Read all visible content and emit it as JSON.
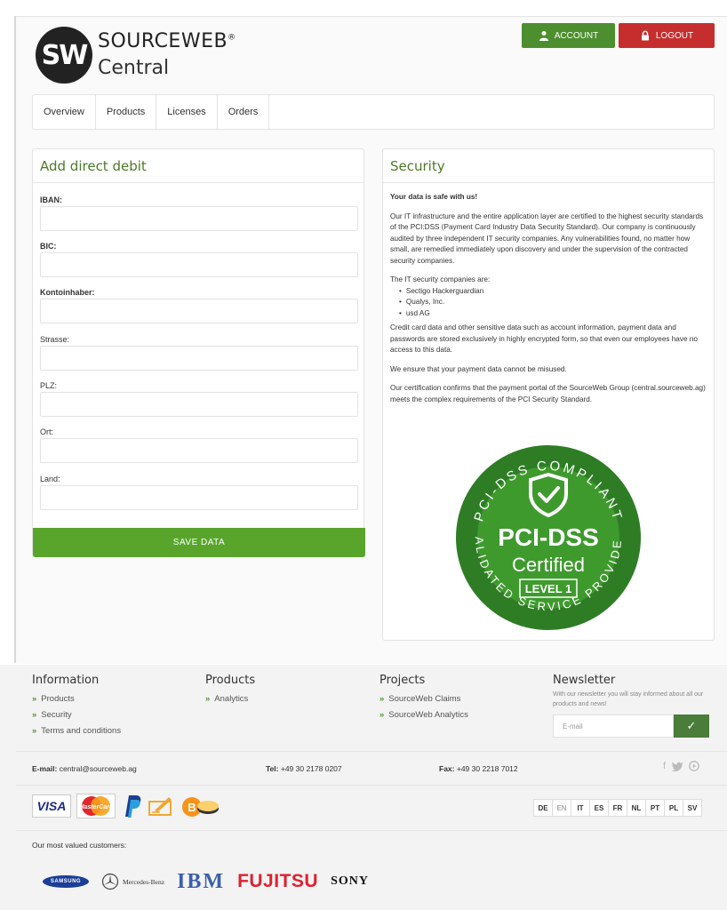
{
  "header": {
    "brand_name": "SOURCEWEB",
    "brand_mark": "®",
    "brand_sub": "Central",
    "logo_letters": "SW",
    "account_label": "ACCOUNT",
    "logout_label": "LOGOUT",
    "account_icon": "user-icon",
    "logout_icon": "lock-icon"
  },
  "nav": {
    "items": [
      {
        "label": "Overview"
      },
      {
        "label": "Products"
      },
      {
        "label": "Licenses"
      },
      {
        "label": "Orders"
      }
    ]
  },
  "debit_form": {
    "title": "Add direct debit",
    "fields": [
      {
        "label": "IBAN:",
        "value": ""
      },
      {
        "label": "BIC:",
        "value": ""
      },
      {
        "label": "Kontoinhaber:",
        "value": ""
      },
      {
        "label": "Strasse:",
        "value": ""
      },
      {
        "label": "PLZ:",
        "value": ""
      },
      {
        "label": "Ort:",
        "value": ""
      },
      {
        "label": "Land:",
        "value": ""
      }
    ],
    "save_label": "SAVE DATA"
  },
  "security": {
    "title": "Security",
    "headline": "Your data is safe with us!",
    "para1": "Our IT infrastructure and the entire application layer are certified to the highest security standards of the PCI:DSS (Payment Card Industry Data Security Standard). Our company is continuously audited by three independent IT security companies. Any vulnerabilities found, no matter how small, are remedied immediately upon discovery and under the supervision of the contracted security companies.",
    "companies_intro": "The IT security companies are:",
    "companies": [
      "Sectigo Hackerguardian",
      "Qualys, Inc.",
      "usd AG"
    ],
    "para2": "Credit card data and other sensitive data such as account information, payment data and passwords are stored exclusively in highly encrypted form, so that even our employees have no access to this data.",
    "para3": "We ensure that your payment data cannot be misused.",
    "para4": "Our certification confirms that the payment portal of the SourceWeb Group (central.sourceweb.ag) meets the complex requirements of the PCI Security Standard.",
    "badge": {
      "top_text": "PCI-DSS COMPLIANT",
      "bottom_text": "VALIDATED SERVICE PROVIDER",
      "main": "PCI-DSS",
      "sub": "Certified",
      "level": "LEVEL 1"
    }
  },
  "footer": {
    "information": {
      "title": "Information",
      "links": [
        "Products",
        "Security",
        "Terms and conditions"
      ]
    },
    "products": {
      "title": "Products",
      "links": [
        "Analytics"
      ]
    },
    "projects": {
      "title": "Projects",
      "links": [
        "SourceWeb Claims",
        "SourceWeb Analytics"
      ]
    },
    "newsletter": {
      "title": "Newsletter",
      "text": "With our newsletter you will stay informed about all our products and news!",
      "placeholder": "E-mail"
    },
    "contact": {
      "email_label": "E-mail:",
      "email": "central@sourceweb.ag",
      "tel_label": "Tel:",
      "tel": "+49 30 2178 0207",
      "fax_label": "Fax:",
      "fax": "+49 30 2218 7012"
    },
    "social_icons": [
      "facebook-icon",
      "twitter-icon",
      "youtube-icon"
    ],
    "payment": {
      "visa": "VISA",
      "mastercard": "MasterCard"
    },
    "languages": [
      "DE",
      "EN",
      "IT",
      "ES",
      "FR",
      "NL",
      "PT",
      "PL",
      "SV"
    ],
    "active_language": "EN",
    "customers_label": "Our most valued customers:",
    "customers": [
      "SAMSUNG",
      "Mercedes-Benz",
      "IBM",
      "FUJITSU",
      "SONY"
    ]
  },
  "colors": {
    "accent_green": "#4d8f2f",
    "save_green": "#59a52c",
    "logout_red": "#c62e2e",
    "title_green": "#4d7a29",
    "badge_green": "#2e7d25"
  }
}
